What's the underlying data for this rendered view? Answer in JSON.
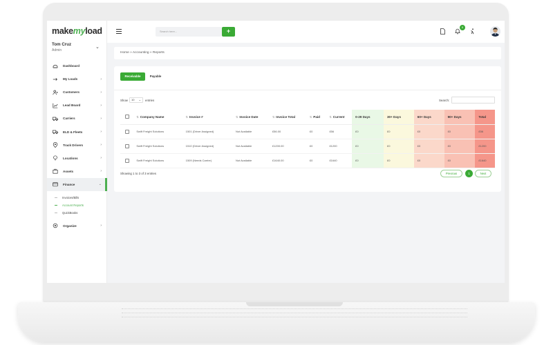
{
  "brand": {
    "part1": "make",
    "part2": "my",
    "part3": "load",
    "accent": "#3aaa35"
  },
  "user": {
    "name": "Tom Cruz",
    "role": "Admin"
  },
  "nav": {
    "items": [
      {
        "label": "Dashboard",
        "icon": "dashboard-icon",
        "has_chevron": false
      },
      {
        "label": "My Loads",
        "icon": "truck-arrow-icon",
        "has_chevron": true
      },
      {
        "label": "Customers",
        "icon": "users-icon",
        "has_chevron": true
      },
      {
        "label": "Lead Board",
        "icon": "chart-line-icon",
        "has_chevron": true
      },
      {
        "label": "Carriers",
        "icon": "truck-icon",
        "has_chevron": true
      },
      {
        "label": "ELD & Fleets",
        "icon": "fleet-icon",
        "has_chevron": true
      },
      {
        "label": "Track Drivers",
        "icon": "location-pin-icon",
        "has_chevron": true
      },
      {
        "label": "Locations",
        "icon": "map-pin-icon",
        "has_chevron": true
      },
      {
        "label": "Assets",
        "icon": "briefcase-icon",
        "has_chevron": true
      },
      {
        "label": "Finance",
        "icon": "wallet-icon",
        "has_chevron": true,
        "active": true
      }
    ],
    "finance_sub": [
      {
        "label": "Invoices/Bills"
      },
      {
        "label": "Account Reports",
        "active": true
      },
      {
        "label": "QuickBooks"
      }
    ],
    "organize": {
      "label": "Organize",
      "icon": "settings-icon"
    }
  },
  "header": {
    "search_placeholder": "Search here...",
    "search_button": "+",
    "notification_count": "0"
  },
  "breadcrumb": "Home  »  Accounting  »  Reports",
  "tabs": {
    "receivable": "Receivable",
    "payable": "Payable"
  },
  "table_controls": {
    "show": "Show",
    "page_size": "10",
    "entries": "entries",
    "search_label": "Search:"
  },
  "table": {
    "headers": [
      "Company Name",
      "Invoice #",
      "Invoice Date",
      "Invoice Total",
      "Paid",
      "Current",
      "0-29 Days",
      "30+ Days",
      "60+ Days",
      "90+ Days",
      "Total"
    ],
    "rows": [
      [
        "Swift Freight Solutions",
        "1501 (Driver Assigned)",
        "Not Available",
        "£56.00",
        "£0",
        "£56",
        "£0",
        "£0",
        "£0",
        "£0",
        "£56"
      ],
      [
        "Swift Freight Solutions",
        "1510 (Driver Assigned)",
        "Not Available",
        "£1200.00",
        "£0",
        "£1200",
        "£0",
        "£0",
        "£0",
        "£0",
        "£1200"
      ],
      [
        "Swift Freight Solutions",
        "1509 (Needs Carrier)",
        "Not Available",
        "£1640.00",
        "£0",
        "£1640",
        "£0",
        "£0",
        "£0",
        "£0",
        "£1640"
      ]
    ],
    "showing": "Showing 1 to 3 of 3 entries"
  },
  "pagination": {
    "previous": "Previous",
    "page": "1",
    "next": "Next"
  }
}
